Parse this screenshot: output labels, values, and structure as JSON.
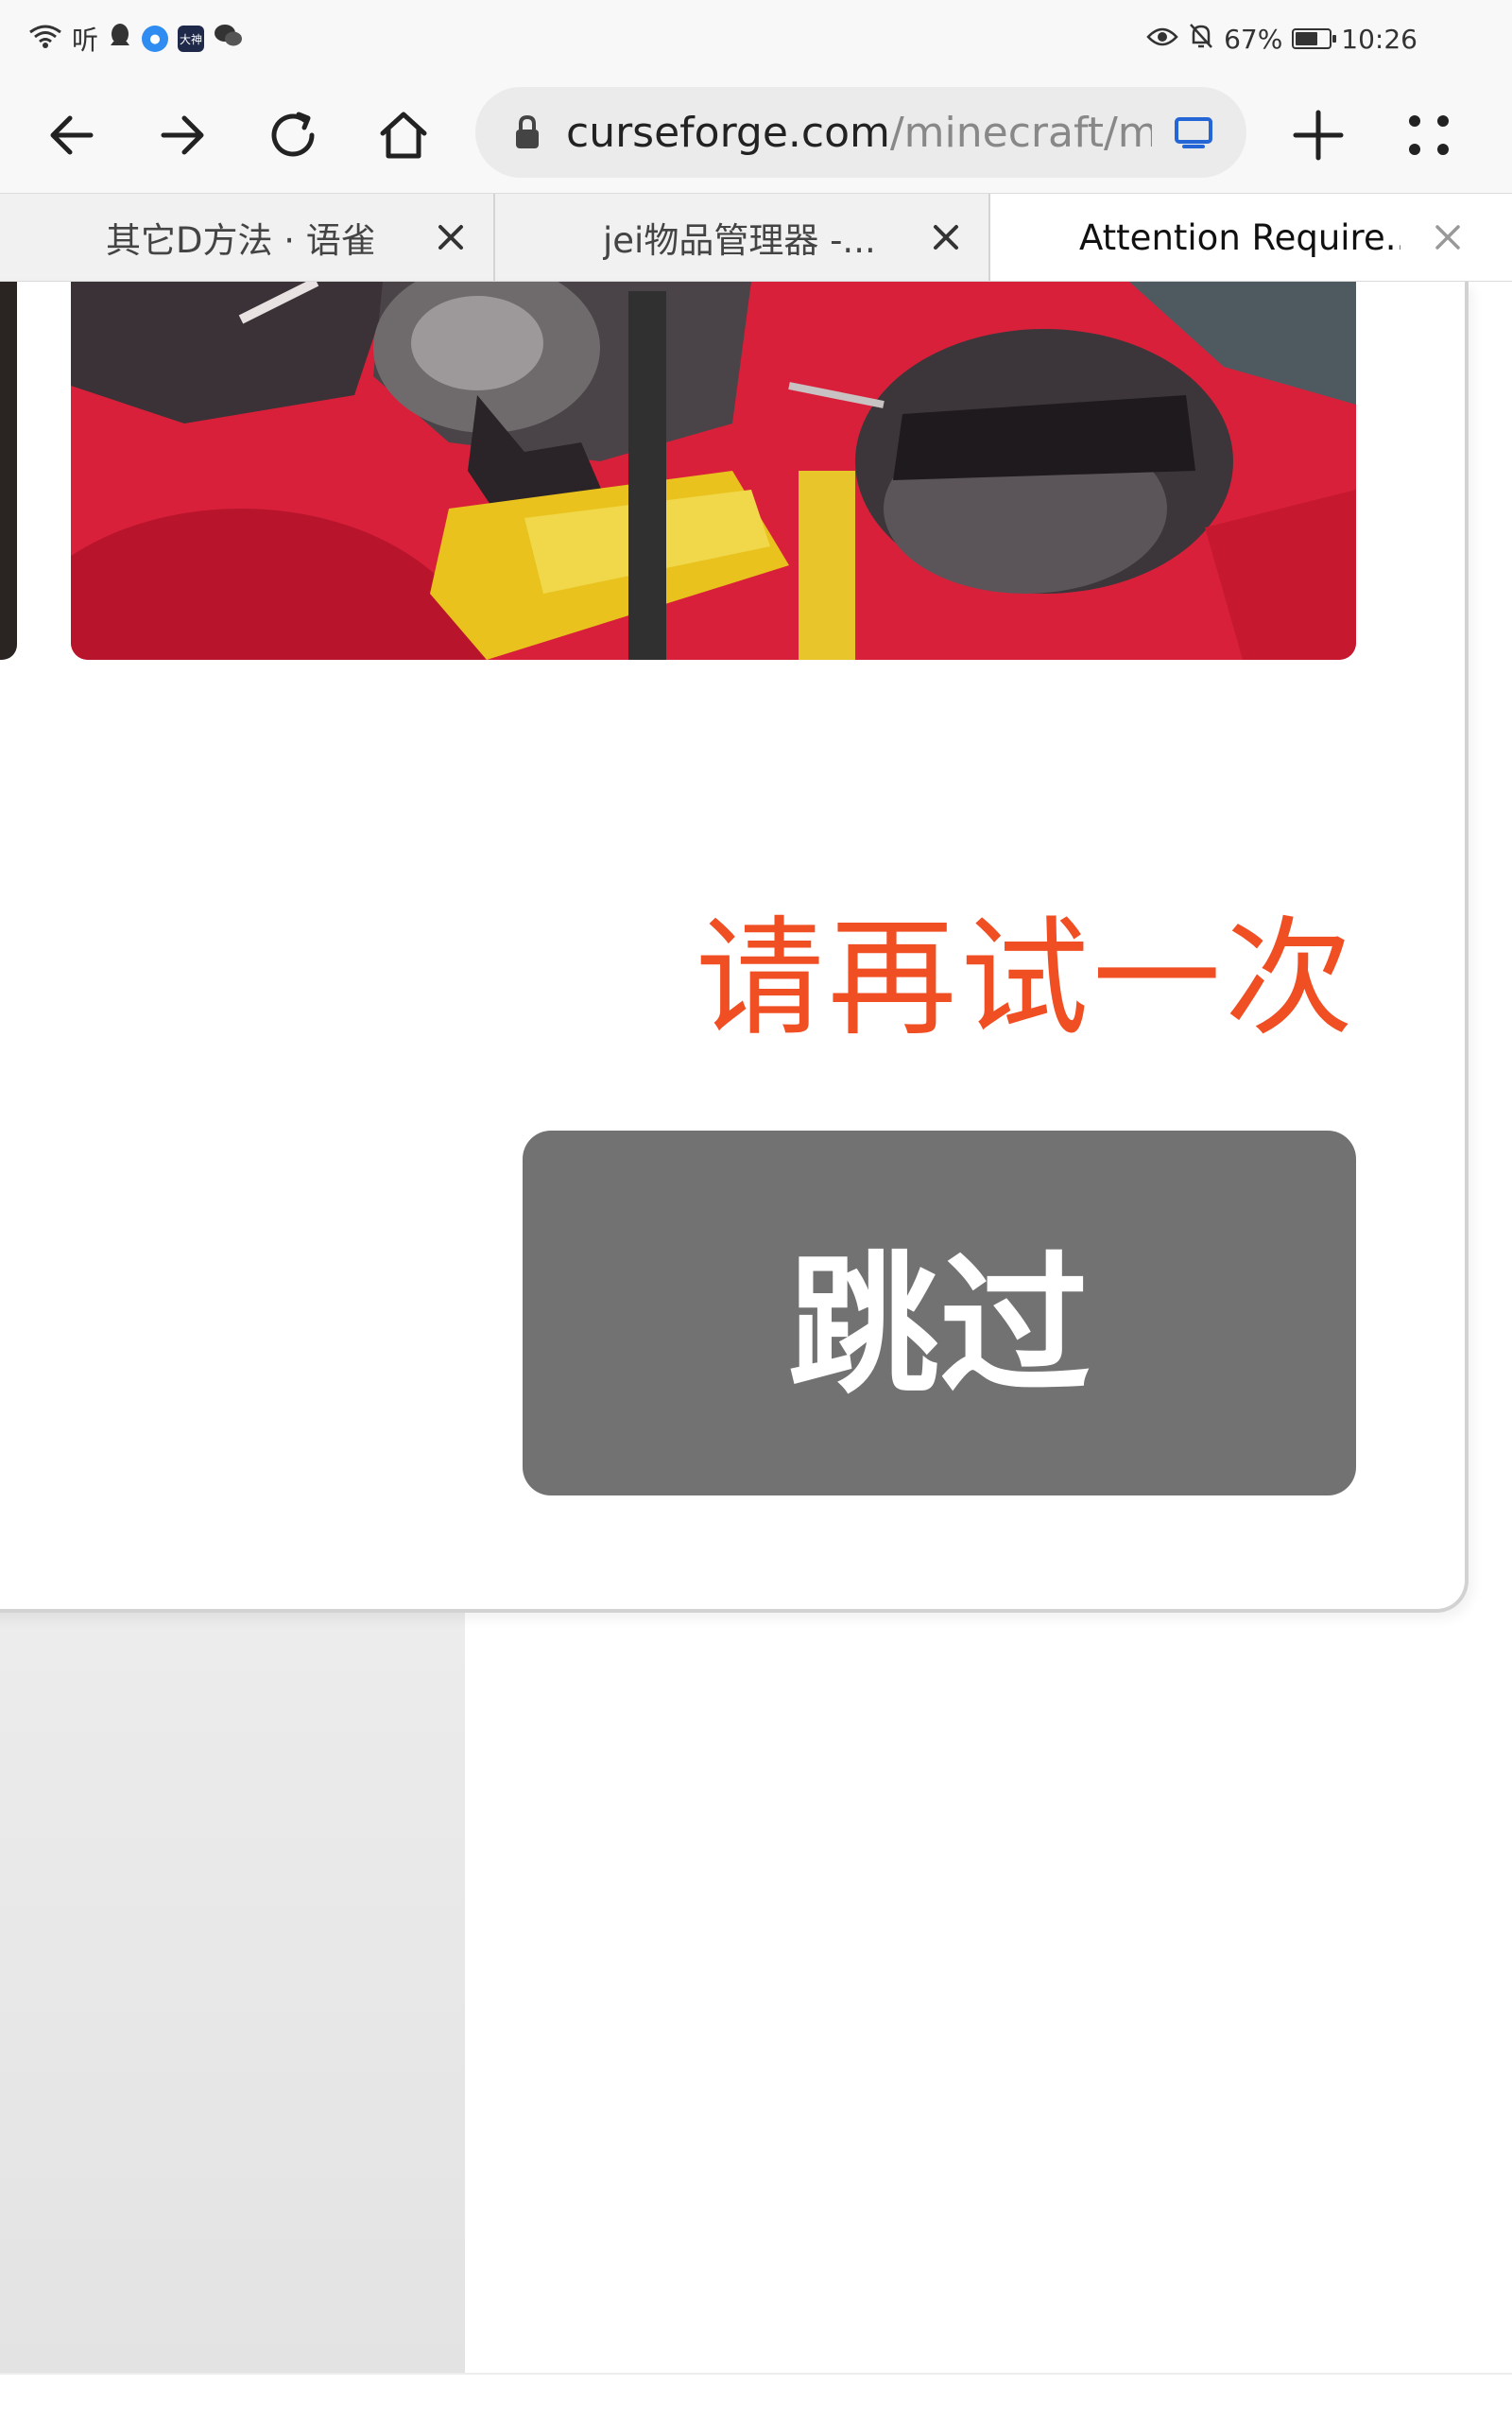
{
  "status_bar": {
    "left_text": "听",
    "app_label": "大神",
    "battery": "67%",
    "battery_level": 0.67,
    "time": "10:26"
  },
  "browser": {
    "url_domain": "curseforge.com",
    "url_path": "/minecraft/m",
    "tabs": [
      {
        "title": "其它D方法 · 语雀",
        "active": false
      },
      {
        "title": "jei物品管理器 -...",
        "active": false
      },
      {
        "title": "Attention Require...",
        "active": true
      }
    ]
  },
  "captcha": {
    "retry_text": "请再试一次",
    "skip_label": "跳过"
  },
  "colors": {
    "retry": "#f04e23",
    "skip_button": "#727272"
  }
}
